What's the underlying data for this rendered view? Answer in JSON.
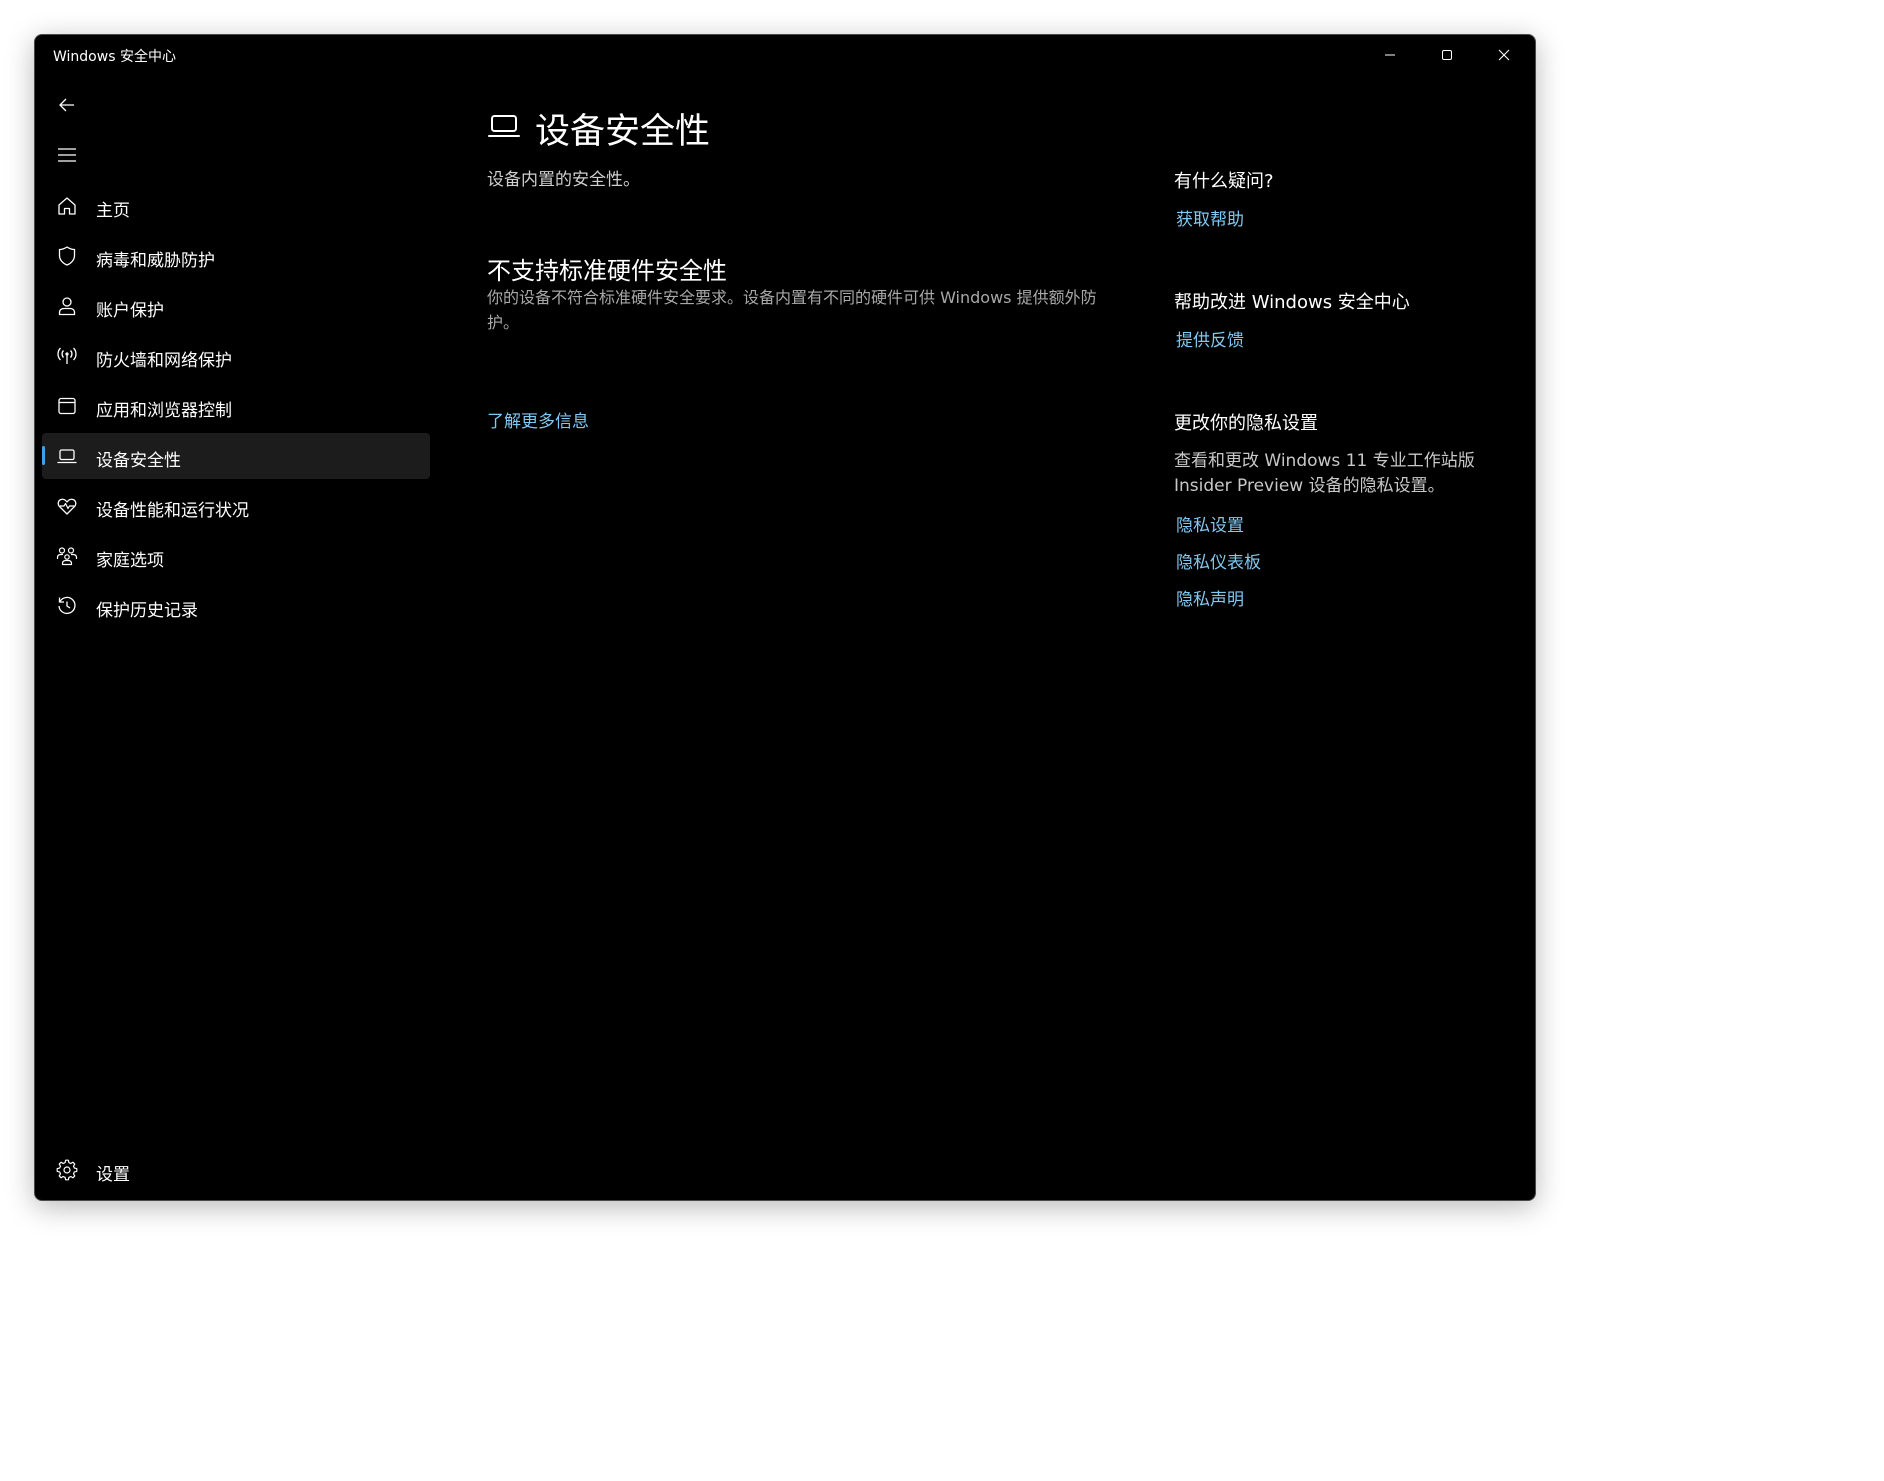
{
  "window": {
    "title": "Windows 安全中心"
  },
  "nav": {
    "items": [
      {
        "label": "主页",
        "icon": "home-icon"
      },
      {
        "label": "病毒和威胁防护",
        "icon": "shield-icon"
      },
      {
        "label": "账户保护",
        "icon": "person-icon"
      },
      {
        "label": "防火墙和网络保护",
        "icon": "antenna-icon"
      },
      {
        "label": "应用和浏览器控制",
        "icon": "app-window-icon"
      },
      {
        "label": "设备安全性",
        "icon": "laptop-icon",
        "selected": true
      },
      {
        "label": "设备性能和运行状况",
        "icon": "heart-pulse-icon"
      },
      {
        "label": "家庭选项",
        "icon": "family-icon"
      },
      {
        "label": "保护历史记录",
        "icon": "history-icon"
      }
    ],
    "settings_label": "设置"
  },
  "main": {
    "title": "设备安全性",
    "subtitle": "设备内置的安全性。",
    "section": {
      "title": "不支持标准硬件安全性",
      "description": "你的设备不符合标准硬件安全要求。设备内置有不同的硬件可供 Windows 提供额外防护。"
    },
    "learn_more": "了解更多信息"
  },
  "aside": {
    "help": {
      "title": "有什么疑问?",
      "link": "获取帮助"
    },
    "improve": {
      "title": "帮助改进 Windows 安全中心",
      "link": "提供反馈"
    },
    "privacy": {
      "title": "更改你的隐私设置",
      "text": "查看和更改 Windows 11 专业工作站版 Insider Preview 设备的隐私设置。",
      "links": [
        "隐私设置",
        "隐私仪表板",
        "隐私声明"
      ]
    }
  },
  "colors": {
    "background": "#000000",
    "accent": "#3ea0e8",
    "link": "#7fc8f2",
    "selected_item": "#1c1c1c"
  }
}
